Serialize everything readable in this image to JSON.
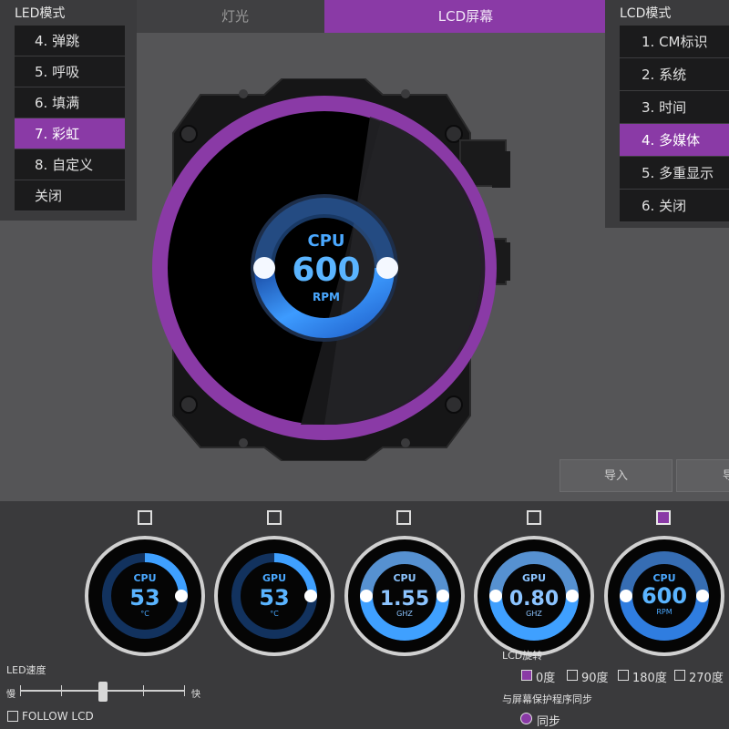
{
  "tabs": [
    {
      "label": "灯光",
      "active": false
    },
    {
      "label": "LCD屏幕",
      "active": true
    }
  ],
  "led_panel": {
    "title": "LED模式",
    "items": [
      {
        "label": "4. 弹跳",
        "active": false
      },
      {
        "label": "5. 呼吸",
        "active": false
      },
      {
        "label": "6. 填满",
        "active": false
      },
      {
        "label": "7. 彩虹",
        "active": true
      },
      {
        "label": "8. 自定义",
        "active": false
      },
      {
        "label": "关闭",
        "active": false
      }
    ]
  },
  "lcd_panel": {
    "title": "LCD模式",
    "items": [
      {
        "label": "1. CM标识",
        "active": false
      },
      {
        "label": "2. 系统",
        "active": false
      },
      {
        "label": "3. 时间",
        "active": false
      },
      {
        "label": "4. 多媒体",
        "active": true
      },
      {
        "label": "5. 多重显示",
        "active": false
      },
      {
        "label": "6. 关闭",
        "active": false
      }
    ]
  },
  "preview": {
    "label": "CPU",
    "value": "600",
    "unit": "RPM"
  },
  "buttons": {
    "import": "导入",
    "export": "导"
  },
  "thumbnails": [
    {
      "label": "CPU",
      "value": "53",
      "unit": "°C",
      "checked": false
    },
    {
      "label": "GPU",
      "value": "53",
      "unit": "°C",
      "checked": false
    },
    {
      "label": "CPU",
      "value": "1.55",
      "unit": "GHZ",
      "checked": false
    },
    {
      "label": "GPU",
      "value": "0.80",
      "unit": "GHZ",
      "checked": false
    },
    {
      "label": "CPU",
      "value": "600",
      "unit": "RPM",
      "checked": true
    }
  ],
  "led_speed": {
    "label": "LED速度",
    "slow": "慢",
    "fast": "快",
    "level": 0.5
  },
  "follow_lcd": {
    "label": "FOLLOW LCD",
    "checked": false
  },
  "lcd_rotation": {
    "label": "LCD旋转",
    "options": [
      {
        "label": "0度",
        "checked": true
      },
      {
        "label": "90度",
        "checked": false
      },
      {
        "label": "180度",
        "checked": false
      },
      {
        "label": "270度",
        "checked": false
      }
    ]
  },
  "screensaver_sync": {
    "label": "与屏幕保护程序同步",
    "option": "同步",
    "selected": true
  },
  "colors": {
    "accent": "#8a3aa6",
    "ring_blue": "#3fa0ff"
  }
}
